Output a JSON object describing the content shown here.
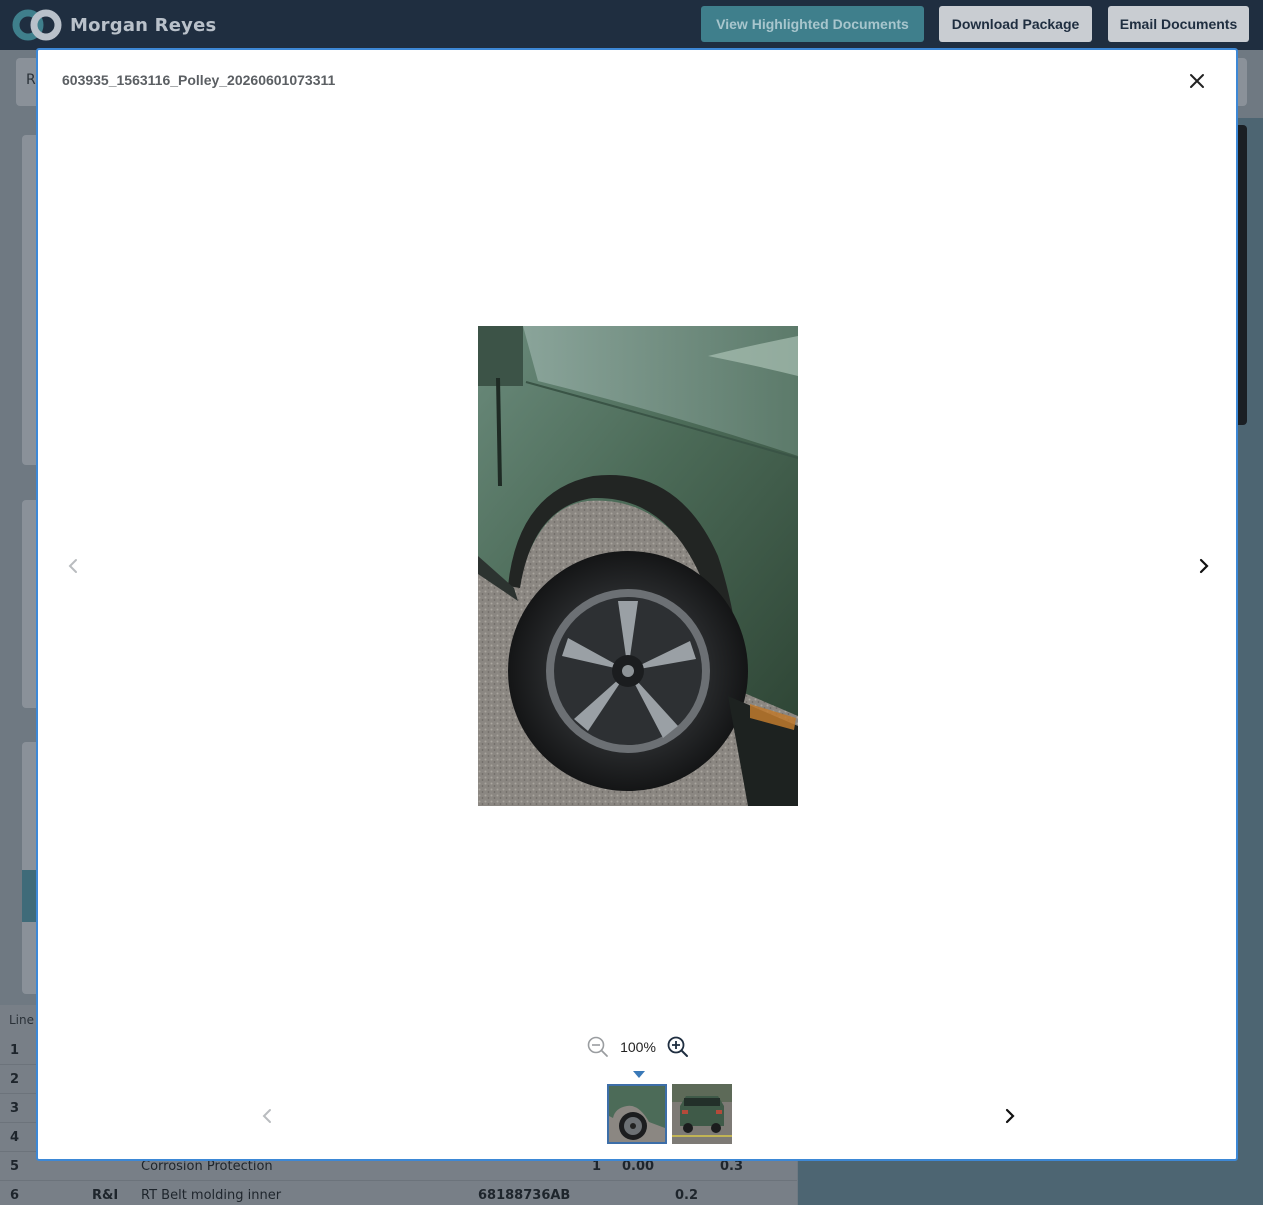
{
  "app": {
    "user_name": "Morgan Reyes",
    "logo_icon": "brand-logo-icon"
  },
  "toolbar": {
    "view_label": "View Highlighted Documents",
    "download_label": "Download Package",
    "email_label": "Email Documents"
  },
  "background": {
    "stub_letter": "R",
    "line_header": "Line",
    "rows": [
      {
        "line": "1",
        "op": "",
        "desc": "",
        "part": "",
        "qty": "",
        "price": "",
        "hours": ""
      },
      {
        "line": "2",
        "op": "",
        "desc": "",
        "part": "",
        "qty": "",
        "price": "",
        "hours": ""
      },
      {
        "line": "3",
        "op": "",
        "desc": "",
        "part": "",
        "qty": "",
        "price": "",
        "hours": ""
      },
      {
        "line": "4",
        "op": "",
        "desc": "",
        "part": "",
        "qty": "",
        "price": "",
        "hours": ""
      },
      {
        "line": "5",
        "op": "",
        "desc": "Corrosion Protection",
        "part": "",
        "qty": "1",
        "price": "0.00",
        "hours": "0.3"
      },
      {
        "line": "6",
        "op": "R&I",
        "desc": "RT Belt molding inner",
        "part": "68188736AB",
        "qty": "",
        "price": "",
        "hours": "0.2"
      }
    ]
  },
  "viewer": {
    "title": "603935_1563116_Polley_20260601073311",
    "zoom_level": "100%",
    "current_index": 1,
    "thumbnails": [
      {
        "name": "thumbnail-fender-wheel",
        "active": true
      },
      {
        "name": "thumbnail-suv-rear",
        "active": false
      }
    ]
  },
  "colors": {
    "topbar": "#1f2e40",
    "accent_teal": "#3f7f8c",
    "modal_border": "#3d88d6",
    "vehicle_green": "#3f5a48"
  }
}
